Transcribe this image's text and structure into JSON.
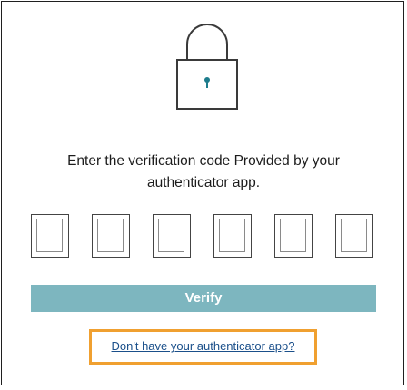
{
  "colors": {
    "frame_border": "#1f1f1f",
    "lock_body": "#3a3a3a",
    "keyhole": "#1d7c8c",
    "verify_button_bg": "#7db6bf",
    "verify_button_text": "#ffffff",
    "help_link": "#1a4f8a",
    "highlight_outline": "#f0a030"
  },
  "lock_icon": "padlock-icon",
  "message": {
    "line1": "Enter the verification code Provided by your",
    "line2": "authenticator app."
  },
  "code_inputs": [
    {
      "value": ""
    },
    {
      "value": ""
    },
    {
      "value": ""
    },
    {
      "value": ""
    },
    {
      "value": ""
    },
    {
      "value": ""
    }
  ],
  "verify_button_label": "Verify",
  "help_link_text": "Don't have your authenticator app?"
}
